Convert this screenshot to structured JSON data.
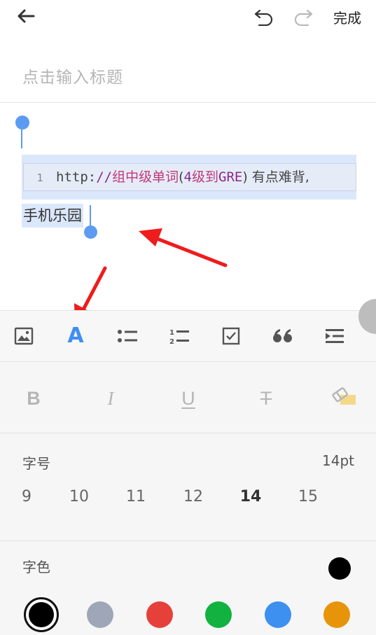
{
  "header": {
    "back_icon": "back-arrow-icon",
    "undo_icon": "undo-icon",
    "redo_icon": "redo-icon",
    "done_label": "完成"
  },
  "title": {
    "placeholder": "点击输入标题"
  },
  "editor": {
    "code_block": {
      "line_number": "1",
      "segments": [
        {
          "text": "http:",
          "color": "#444444"
        },
        {
          "text": "//",
          "color": "#8a2a8a"
        },
        {
          "text": "组中级单词",
          "color": "#c3387a"
        },
        {
          "text": "(",
          "color": "#444444"
        },
        {
          "text": "4",
          "color": "#8a2a8a"
        },
        {
          "text": "级到",
          "color": "#c3387a"
        },
        {
          "text": "GRE",
          "color": "#8a2a8a"
        },
        {
          "text": ") 有点难背,",
          "color": "#444444"
        }
      ]
    },
    "text_line": "手机乐园",
    "selection_color": "#dbe7fb",
    "handle_color": "#5b9bf2"
  },
  "toolbar": {
    "items": [
      {
        "name": "image-icon",
        "active": false
      },
      {
        "name": "font-style-icon",
        "active": true
      },
      {
        "name": "bullet-list-icon",
        "active": false
      },
      {
        "name": "numbered-list-icon",
        "active": false
      },
      {
        "name": "checkbox-icon",
        "active": false
      },
      {
        "name": "quote-icon",
        "active": false
      },
      {
        "name": "indent-icon",
        "active": false
      }
    ],
    "accent": "#3f8ef5"
  },
  "format": {
    "bold": "B",
    "italic": "I",
    "underline": "U",
    "strike": "T",
    "clear_icon": "eraser-icon"
  },
  "font_size": {
    "label": "字号",
    "current": "14pt",
    "options": [
      "9",
      "10",
      "11",
      "12",
      "14",
      "15"
    ],
    "selected": "14"
  },
  "font_color": {
    "label": "字色",
    "current": "#000000",
    "swatches": [
      "#000000",
      "#9ea6b7",
      "#e6403a",
      "#11b240",
      "#3d8ff0",
      "#e8940a"
    ],
    "selected": "#000000"
  }
}
